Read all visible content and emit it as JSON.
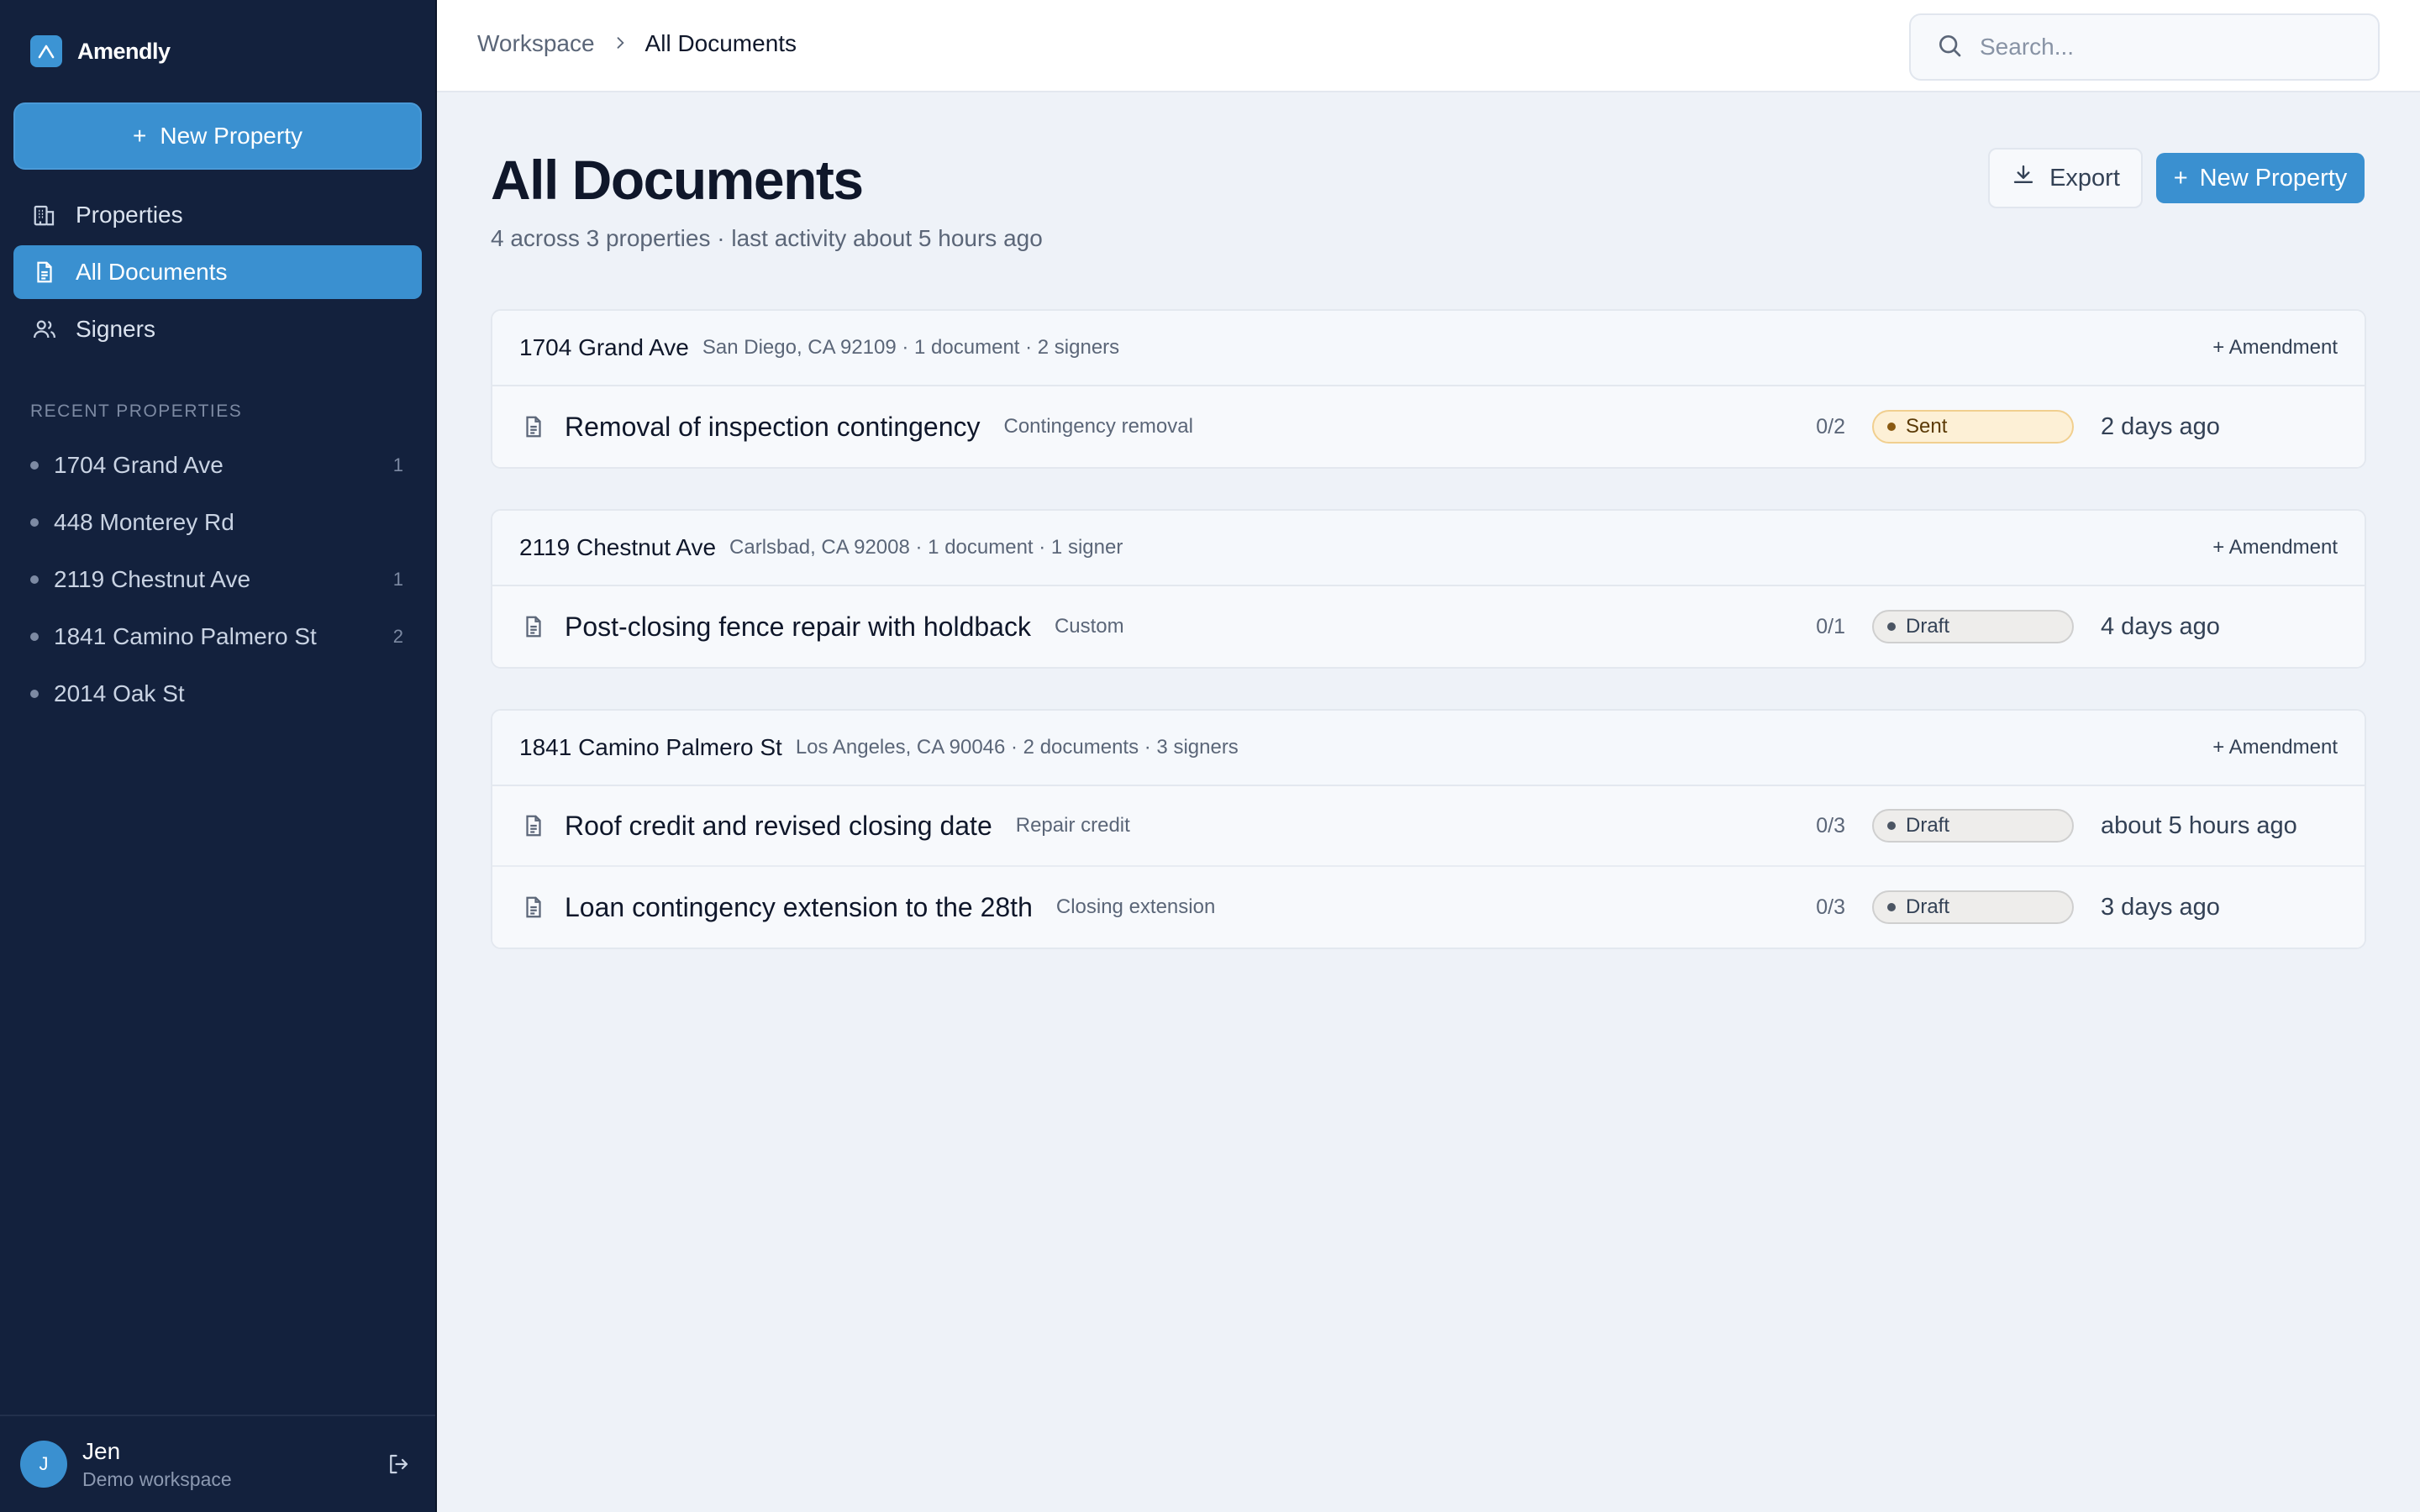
{
  "app": {
    "name": "Amendly"
  },
  "colors": {
    "sidebar": "#13213d",
    "accent": "#3a90d0",
    "sent_bg": "#fdf0d6",
    "draft_bg": "#eeedeb"
  },
  "sidebar": {
    "new_button": "New Property",
    "nav": [
      {
        "label": "Properties",
        "icon": "building-icon"
      },
      {
        "label": "All Documents",
        "icon": "document-icon",
        "active": true
      },
      {
        "label": "Signers",
        "icon": "users-icon"
      }
    ],
    "recent_heading": "RECENT PROPERTIES",
    "recent": [
      {
        "name": "1704 Grand Ave",
        "count": "1"
      },
      {
        "name": "448 Monterey Rd",
        "count": ""
      },
      {
        "name": "2119 Chestnut Ave",
        "count": "1"
      },
      {
        "name": "1841 Camino Palmero St",
        "count": "2"
      },
      {
        "name": "2014 Oak St",
        "count": ""
      }
    ],
    "user": {
      "initial": "J",
      "name": "Jen",
      "workspace": "Demo workspace"
    }
  },
  "topbar": {
    "breadcrumb": [
      "Workspace",
      "All Documents"
    ],
    "search_placeholder": "Search..."
  },
  "main": {
    "title": "All Documents",
    "subtitle": "4 across 3 properties · last activity about 5 hours ago",
    "export_label": "Export",
    "new_property_label": "New Property",
    "groups": [
      {
        "name": "1704 Grand Ave",
        "meta": "San Diego, CA 92109 · 1 document · 2 signers",
        "amend": "+ Amendment",
        "docs": [
          {
            "title": "Removal of inspection contingency",
            "type": "Contingency removal",
            "count": "0/2",
            "status": "Sent",
            "time": "2 days ago"
          }
        ]
      },
      {
        "name": "2119 Chestnut Ave",
        "meta": "Carlsbad, CA 92008 · 1 document · 1 signer",
        "amend": "+ Amendment",
        "docs": [
          {
            "title": "Post-closing fence repair with holdback",
            "type": "Custom",
            "count": "0/1",
            "status": "Draft",
            "time": "4 days ago"
          }
        ]
      },
      {
        "name": "1841 Camino Palmero St",
        "meta": "Los Angeles, CA 90046 · 2 documents · 3 signers",
        "amend": "+ Amendment",
        "docs": [
          {
            "title": "Roof credit and revised closing date",
            "type": "Repair credit",
            "count": "0/3",
            "status": "Draft",
            "time": "about 5 hours ago"
          },
          {
            "title": "Loan contingency extension to the 28th",
            "type": "Closing extension",
            "count": "0/3",
            "status": "Draft",
            "time": "3 days ago"
          }
        ]
      }
    ]
  }
}
